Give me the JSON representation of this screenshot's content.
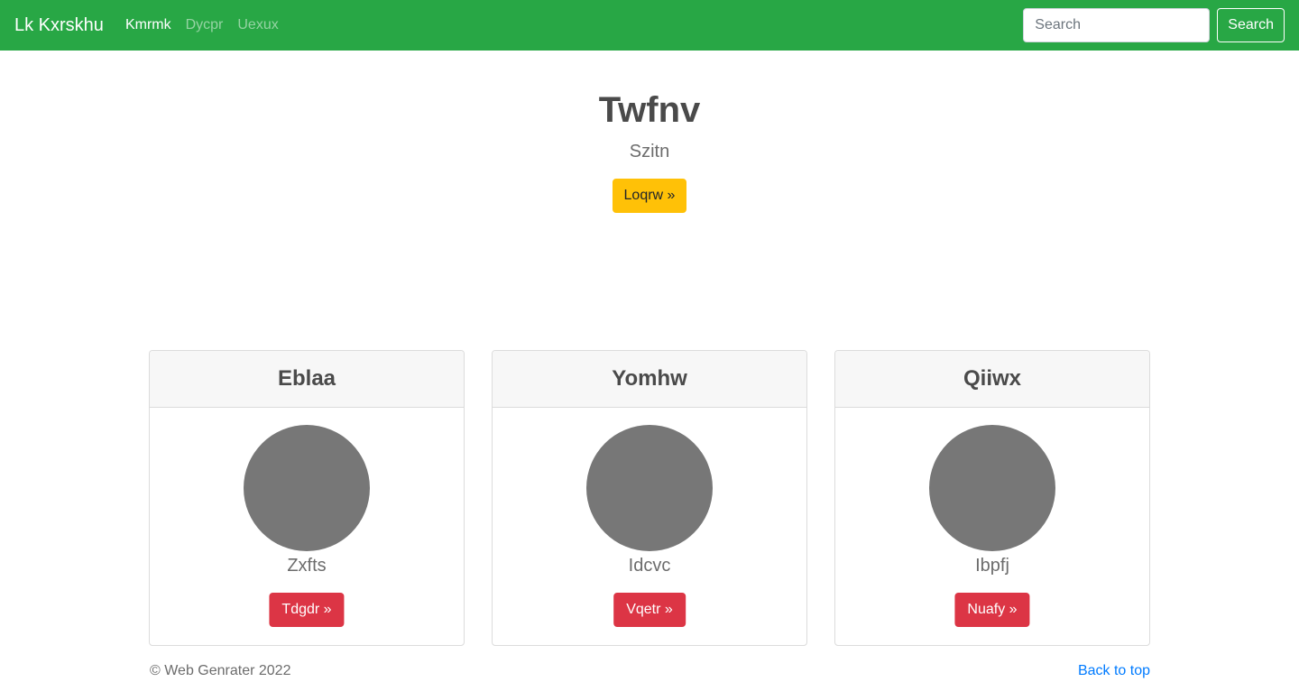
{
  "navbar": {
    "brand": "Lk Kxrskhu",
    "links": [
      {
        "label": "Kmrmk",
        "active": true
      },
      {
        "label": "Dycpr",
        "active": false
      },
      {
        "label": "Uexux",
        "active": false
      }
    ],
    "search_placeholder": "Search",
    "search_button": "Search"
  },
  "hero": {
    "title": "Twfnv",
    "subtitle": "Szitn",
    "button": "Loqrw »"
  },
  "cards": [
    {
      "title": "Eblaa",
      "text": "Zxfts",
      "button": "Tdgdr »"
    },
    {
      "title": "Yomhw",
      "text": "Idcvc",
      "button": "Vqetr »"
    },
    {
      "title": "Qiiwx",
      "text": "Ibpfj",
      "button": "Nuafy »"
    }
  ],
  "footer": {
    "copyright": "© Web Genrater 2022",
    "back_to_top": "Back to top"
  },
  "colors": {
    "navbar": "#28a745",
    "hero_button": "#ffc107",
    "card_button": "#dc3545",
    "avatar": "#777777",
    "link": "#007bff"
  }
}
